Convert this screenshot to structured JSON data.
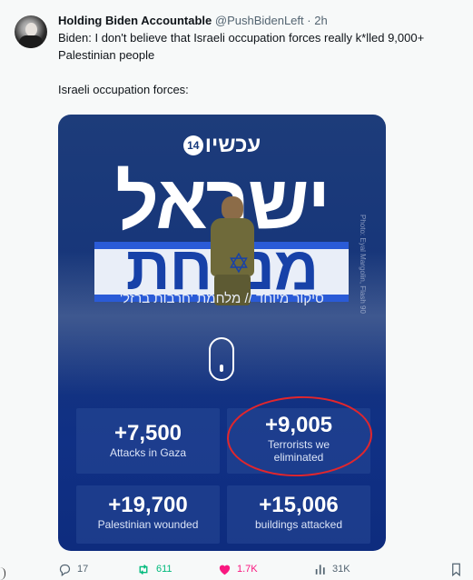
{
  "author": {
    "display_name": "Holding Biden Accountable",
    "handle": "@PushBidenLeft",
    "separator": "·",
    "time": "2h"
  },
  "tweet": {
    "line1": "Biden: I don't believe that Israeli occupation forces really k*lled 9,000+ Palestinian people",
    "line2": "Israeli occupation forces:"
  },
  "media": {
    "brand_text": "עכשיו",
    "brand_badge": "14",
    "headline_top": "ישראל",
    "headline_bottom": "מנצחת",
    "star_glyph": "✡",
    "subtitle": "סיקור מיוחד // מלחמת 'חרבות ברזל'",
    "photo_credit": "Photo: Eyal Margolin, Flash 90",
    "stats": [
      {
        "value": "+7,500",
        "label": "Attacks in Gaza"
      },
      {
        "value": "+9,005",
        "label": "Terrorists we eliminated"
      },
      {
        "value": "+19,700",
        "label": "Palestinian wounded"
      },
      {
        "value": "+15,006",
        "label": "buildings attacked"
      }
    ],
    "colors": {
      "background": "#16357a",
      "headline_blue": "#1741a8",
      "annotation_red": "#e2262c"
    }
  },
  "actions": {
    "replies": "17",
    "retweets": "611",
    "likes": "1.7K",
    "views": "31K",
    "colors": {
      "retweet": "#00ba7c",
      "like": "#f91880",
      "muted": "#536471"
    },
    "icons": [
      "reply-icon",
      "retweet-icon",
      "heart-icon",
      "views-icon",
      "bookmark-icon"
    ]
  }
}
